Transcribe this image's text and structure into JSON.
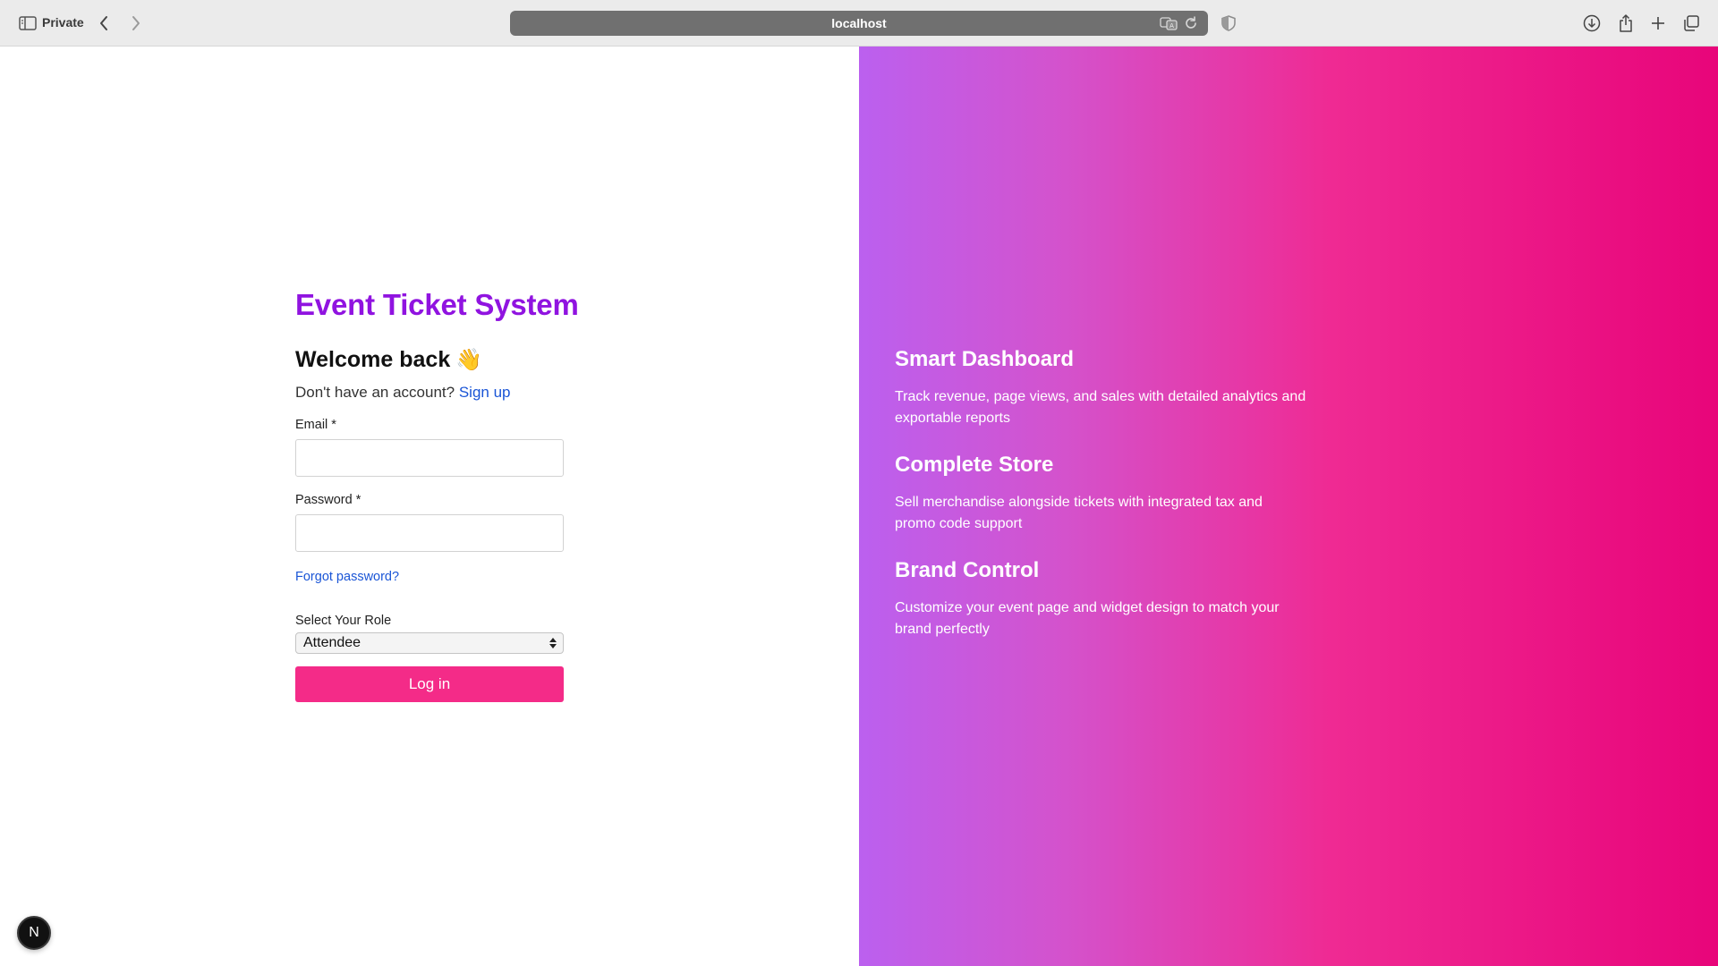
{
  "browser": {
    "private_label": "Private",
    "url": "localhost",
    "icons": {
      "sidebar": "sidebar-icon",
      "back": "chevron-left-icon",
      "forward": "chevron-right-icon",
      "translate": "translate-icon",
      "reload": "reload-icon",
      "shield": "shield-icon",
      "download": "download-icon",
      "share": "share-icon",
      "new_tab": "plus-icon",
      "tabs": "tabs-overview-icon"
    }
  },
  "login": {
    "app_title": "Event Ticket System",
    "welcome": "Welcome back",
    "welcome_emoji": "👋",
    "signup_prompt": "Don't have an account?",
    "signup_link": "Sign up",
    "email_label": "Email *",
    "email_value": "",
    "password_label": "Password *",
    "password_value": "",
    "forgot_password": "Forgot password?",
    "role_label": "Select Your Role",
    "role_selected": "Attendee",
    "submit_label": "Log in"
  },
  "features": [
    {
      "title": "Smart Dashboard",
      "description": "Track revenue, page views, and sales with detailed analytics and exportable reports"
    },
    {
      "title": "Complete Store",
      "description": "Sell merchandise alongside tickets with integrated tax and promo code support"
    },
    {
      "title": "Brand Control",
      "description": "Customize your event page and widget design to match your brand perfectly"
    }
  ],
  "dev_badge": "N",
  "colors": {
    "title_purple": "#9013e0",
    "link_blue": "#1a55d6",
    "button_pink": "#f42b88",
    "gradient_start": "#bb60ef",
    "gradient_end": "#e8057a"
  }
}
